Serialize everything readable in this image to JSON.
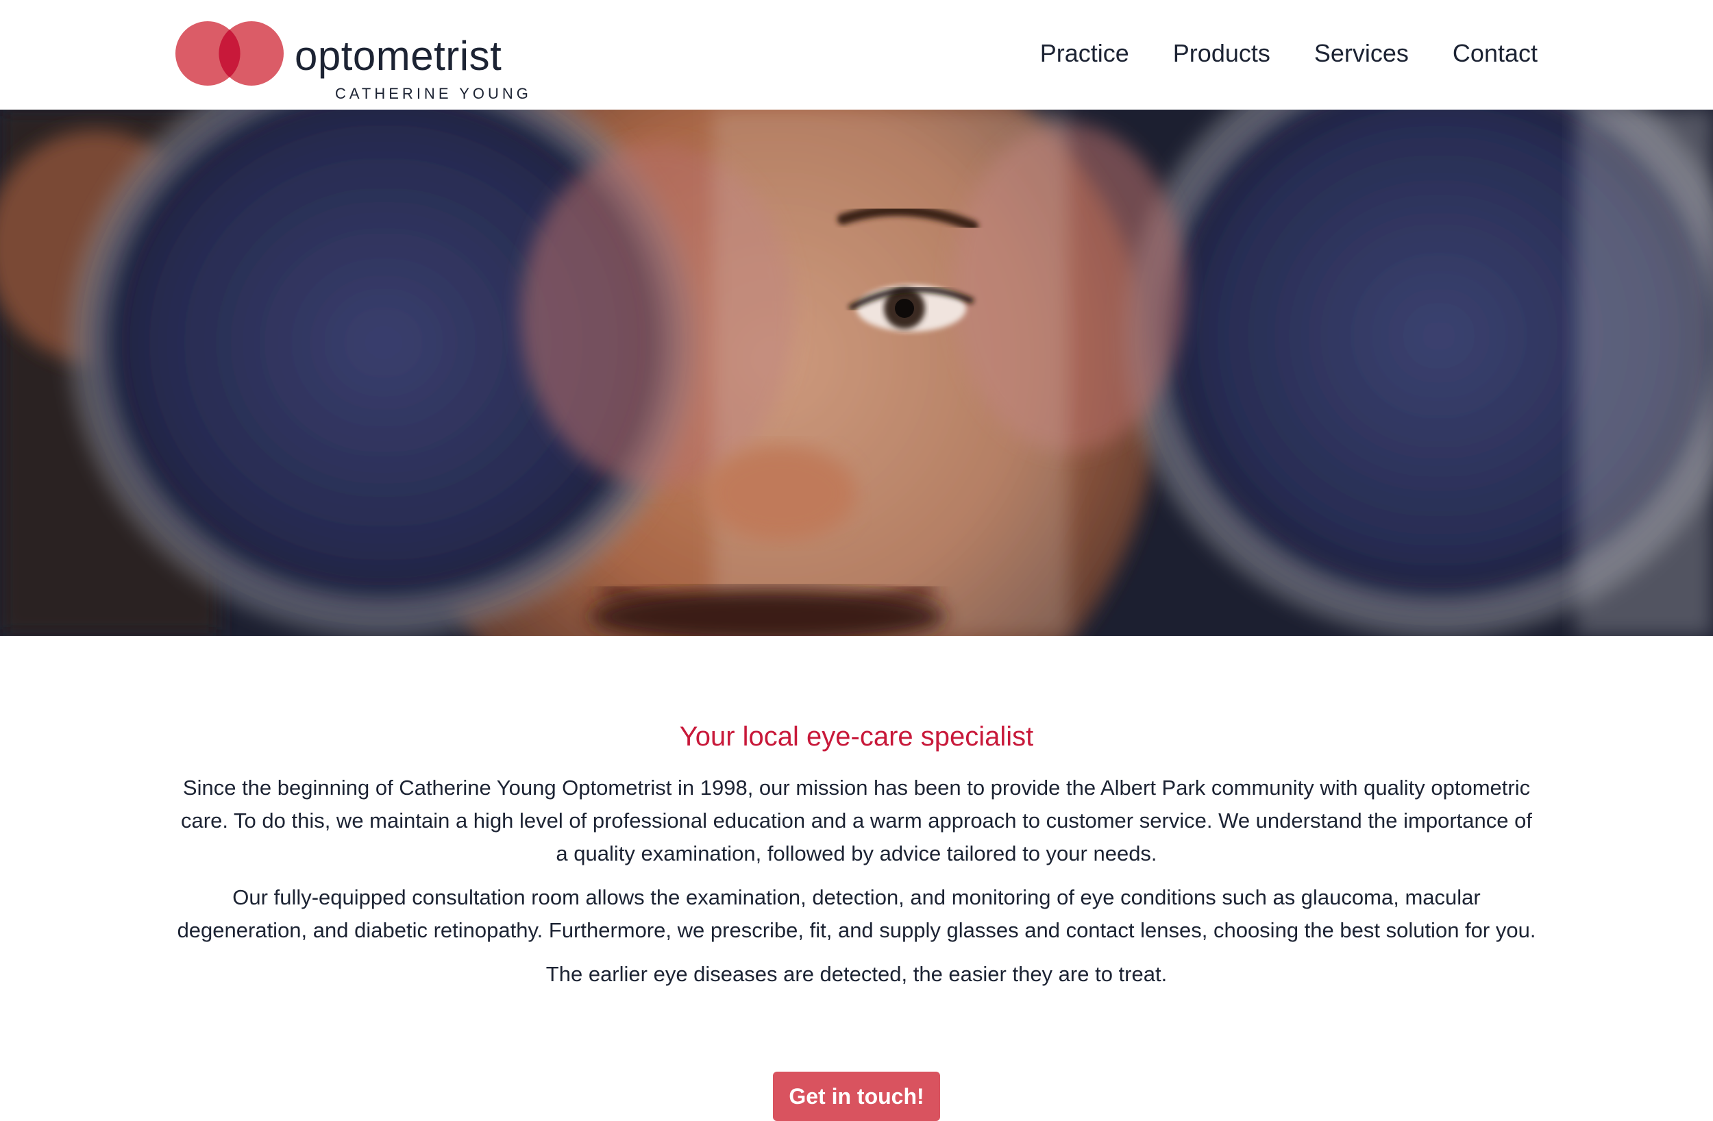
{
  "brand": {
    "title": "optometrist",
    "subtitle": "CATHERINE YOUNG",
    "accent_color": "#d9535f",
    "overlap_color": "#c8193a"
  },
  "nav": {
    "items": [
      {
        "label": "Practice"
      },
      {
        "label": "Products"
      },
      {
        "label": "Services"
      },
      {
        "label": "Contact"
      }
    ]
  },
  "hero": {
    "image": "smiling-woman-through-lens-icon"
  },
  "main": {
    "headline": "Your local eye-care specialist",
    "paragraphs": [
      "Since the beginning of Catherine Young Optometrist in 1998, our mission has been to provide the Albert Park community with quality optometric care. To do this, we maintain a high level of professional education and a warm approach to customer service. We understand the importance of a quality examination, followed by advice tailored to your needs.",
      "Our fully-equipped consultation room allows the examination, detection, and monitoring of eye conditions such as glaucoma, macular degeneration, and diabetic retinopathy. Furthermore, we prescribe, fit, and supply glasses and contact lenses, choosing the best solution for you.",
      "The earlier eye diseases are detected, the easier they are to treat."
    ],
    "cta_label": "Get in touch!"
  },
  "colors": {
    "headline": "#c8193a",
    "text": "#1c2333",
    "button": "#d9535f"
  }
}
